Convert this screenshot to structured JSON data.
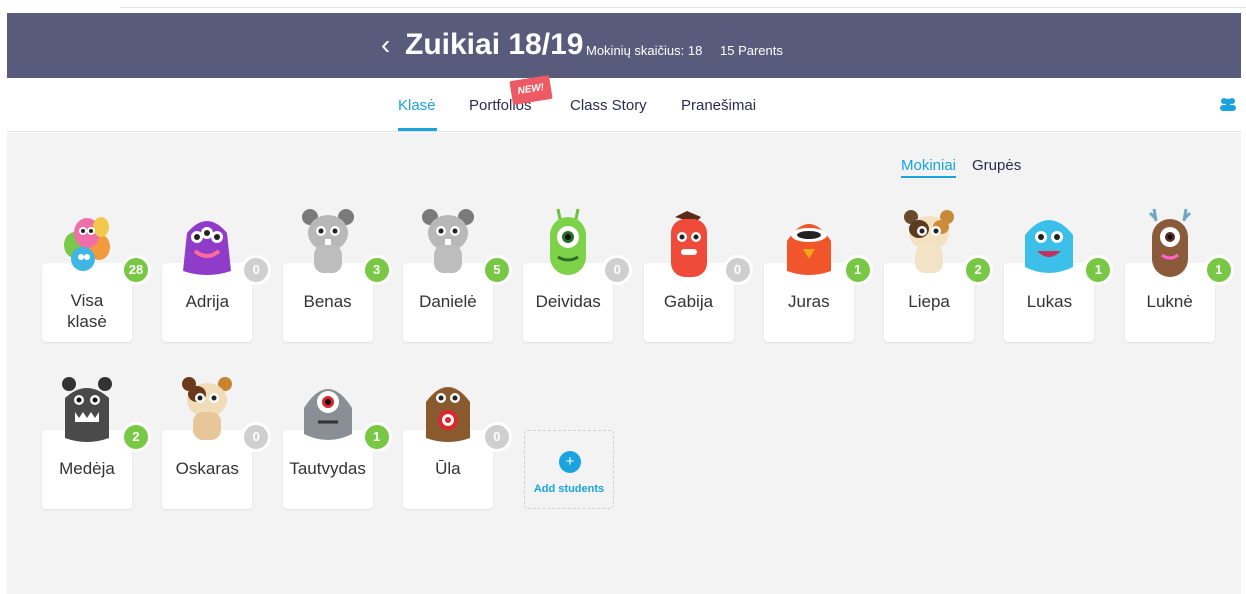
{
  "header": {
    "back_icon": "chevron-left-icon",
    "title": "Zuikiai 18/19",
    "students_count": "Mokinių skaičius: 18",
    "parents_count": "15 Parents",
    "background_color": "#595b7c"
  },
  "nav": {
    "tabs": [
      {
        "label": "Klasė",
        "active": true
      },
      {
        "label": "Portfolios",
        "active": false
      },
      {
        "label": "Class Story",
        "active": false
      },
      {
        "label": "Pranešimai",
        "active": false
      }
    ],
    "new_badge": "NEW!",
    "accent_color": "#1aa3dd"
  },
  "view_toggle": {
    "students": "Mokiniai",
    "groups": "Grupės"
  },
  "students": [
    {
      "name": "Visa\nklasė",
      "points": "28",
      "avatar": "whole-class-monsters"
    },
    {
      "name": "Adrija",
      "points": "0",
      "avatar": "purple-monster"
    },
    {
      "name": "Benas",
      "points": "3",
      "avatar": "grey-hamster-monster"
    },
    {
      "name": "Danielė",
      "points": "5",
      "avatar": "grey-hamster-monster"
    },
    {
      "name": "Deividas",
      "points": "0",
      "avatar": "green-one-eyed-monster"
    },
    {
      "name": "Gabija",
      "points": "0",
      "avatar": "red-monster"
    },
    {
      "name": "Juras",
      "points": "1",
      "avatar": "orange-monster"
    },
    {
      "name": "Liepa",
      "points": "2",
      "avatar": "calico-hamster-monster"
    },
    {
      "name": "Lukas",
      "points": "1",
      "avatar": "blue-furry-monster"
    },
    {
      "name": "Luknė",
      "points": "1",
      "avatar": "brown-antler-monster"
    },
    {
      "name": "Medėja",
      "points": "2",
      "avatar": "black-monster"
    },
    {
      "name": "Oskaras",
      "points": "0",
      "avatar": "brown-hamster-monster"
    },
    {
      "name": "Tautvydas",
      "points": "1",
      "avatar": "grey-one-eyed-monster"
    },
    {
      "name": "Ūla",
      "points": "0",
      "avatar": "brown-owl-monster"
    }
  ],
  "add_students": {
    "label": "Add students",
    "icon": "plus-icon"
  },
  "colors": {
    "points_green": "#78c845",
    "points_grey": "#cfcfcf"
  }
}
